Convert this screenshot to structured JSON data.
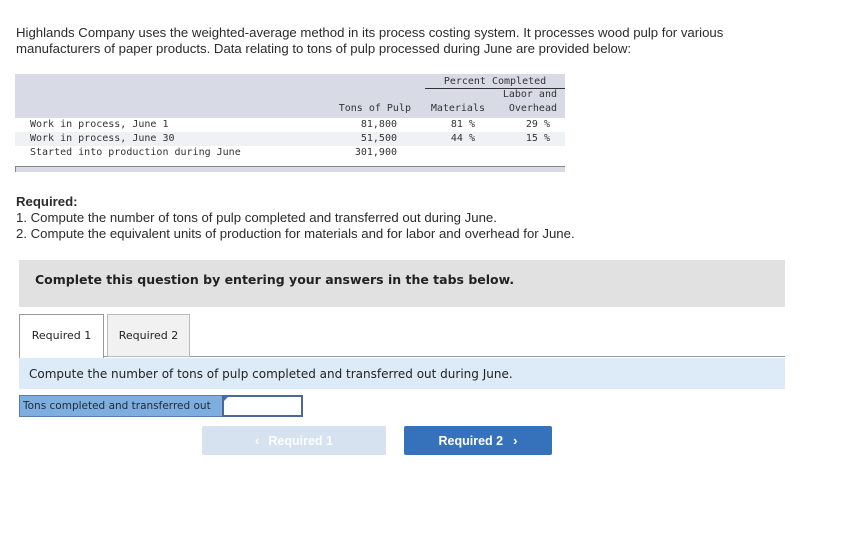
{
  "intro": {
    "text": "Highlands Company uses the weighted-average method in its process costing system. It processes wood pulp for various manufacturers of paper products. Data relating to tons of pulp processed during June are provided below:"
  },
  "data_table": {
    "header": {
      "group_label": "Percent Completed",
      "tons_label": "Tons of Pulp",
      "materials_label": "Materials",
      "labor_label_line1": "Labor and",
      "labor_label_line2": "Overhead"
    },
    "rows": [
      {
        "label": "Work in process, June 1",
        "tons": "81,800",
        "materials": "81 %",
        "labor": "29 %"
      },
      {
        "label": "Work in process, June 30",
        "tons": "51,500",
        "materials": "44 %",
        "labor": "15 %"
      },
      {
        "label": "Started into production during June",
        "tons": "301,900",
        "materials": "",
        "labor": ""
      }
    ]
  },
  "required": {
    "title": "Required:",
    "items": [
      "1. Compute the number of tons of pulp completed and transferred out during June.",
      "2. Compute the equivalent units of production for materials and for labor and overhead for June."
    ]
  },
  "banner": {
    "text": "Complete this question by entering your answers in the tabs below."
  },
  "tabs": [
    {
      "label": "Required 1",
      "active": true
    },
    {
      "label": "Required 2",
      "active": false
    }
  ],
  "prompt": {
    "text": "Compute the number of tons of pulp completed and transferred out during June."
  },
  "answer": {
    "label": "Tons completed and transferred out",
    "value": "",
    "placeholder": ""
  },
  "navigation": {
    "prev_label": "Required 1",
    "prev_icon": "chevron-left-icon",
    "prev_glyph": "‹",
    "next_label": "Required 2",
    "next_icon": "chevron-right-icon",
    "next_glyph": "›"
  },
  "colors": {
    "banner_bg": "#e1e1e1",
    "prompt_bg": "#dcebf7",
    "answer_label_bg": "#7eaee0",
    "next_button_bg": "#3672bb",
    "prev_button_bg": "#d6e2f0",
    "table_header_bg": "#d8dbe5"
  }
}
